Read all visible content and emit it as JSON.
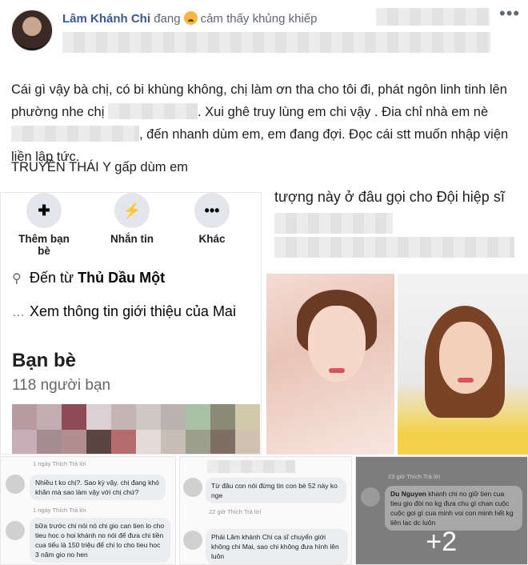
{
  "post": {
    "author": "Lâm Khánh Chi",
    "feeling_prefix": "đang",
    "feeling_text": "cảm thấy khủng khiếp",
    "text_p1": "Cái gì vậy bà chị, có bi khùng không, chị làm ơn tha cho tôi đi, phát ngôn linh tinh lên phường nhe chị",
    "text_p2": ". Xui ghê truy lùng em chi vậy . Đia chỉ nhà em nè",
    "text_p3": ", đến nhanh dùm em, em đang đợi. Đọc cái stt muốn nhập viện liền lập tức.",
    "text_line2": "TRUYỀN THÁI Y gấp dùm em"
  },
  "profile_card": {
    "actions": [
      {
        "label": "Thêm bạn bè",
        "icon": "add-friend-icon"
      },
      {
        "label": "Nhắn tin",
        "icon": "messenger-icon"
      },
      {
        "label": "Khác",
        "icon": "more-icon"
      }
    ],
    "from_prefix": "Đến từ",
    "from_place": "Thủ Dầu Một",
    "about_text": "Xem thông tin giới thiệu của Mai",
    "friends_title": "Bạn bè",
    "friends_count": "118 người bạn"
  },
  "side_text": "tượng này ở đâu gọi cho Đội hiệp sĩ",
  "comments": {
    "c1": {
      "meta1": "1 ngày   Thích   Trả lời",
      "bubble1": "Nhiều t ko chị?. Sao kỳ vậy. chị đang khó khăn mà sao làm vậy với chị chứ?",
      "meta2": "1 ngày   Thích   Trả lời",
      "bubble2": "bữa trước chi nói nó chi gio can tien lo cho tieu hoc o hoi khánh no nói để đưa chi tiền cua tiểu là 150 triệu để chi lo cho tieu hoc 3 năm gio no hen"
    },
    "c2": {
      "bubble1": "Từ đâu con nói đừng tin con bè 52 này ko nge",
      "meta1": "22 giờ   Thích   Trả lời",
      "bubble2": "Phải Lâm khánh Chi ca sĩ chuyển giới không chi Mai, sao chi không đưa hình lên luôn"
    },
    "c3": {
      "meta1": "23 giờ   Thích   Trả lời",
      "author": "Du Nguyen",
      "bubble1": "khanh chi no giữ tien cua tieu gio đòi no kg đưa chu gì chan cuộc cuộc goi gì cua minh voi con minh hết kg liên lạc dc luôn",
      "more": "+2"
    }
  }
}
